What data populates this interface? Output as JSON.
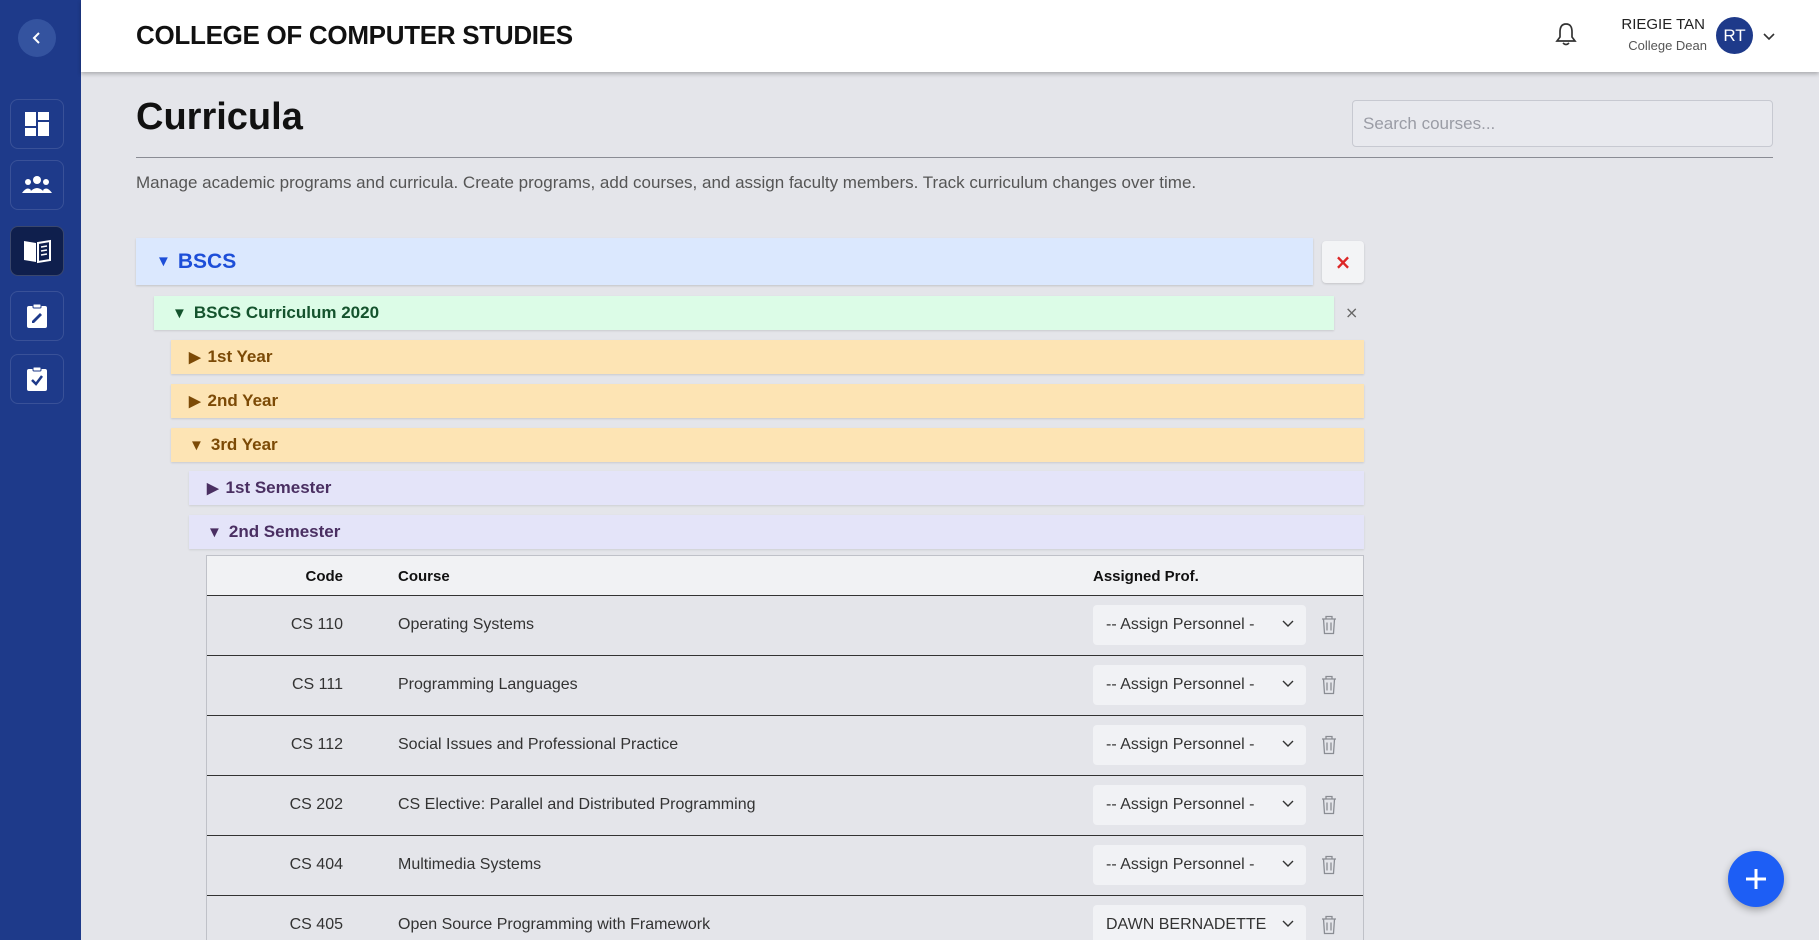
{
  "header": {
    "college_title": "COLLEGE OF COMPUTER STUDIES",
    "user_name": "RIEGIE TAN",
    "user_role": "College Dean",
    "avatar_initials": "RT"
  },
  "sidebar": {
    "items": [
      {
        "icon": "dashboard-icon"
      },
      {
        "icon": "users-icon"
      },
      {
        "icon": "book-icon",
        "active": true
      },
      {
        "icon": "clipboard-edit-icon"
      },
      {
        "icon": "clipboard-check-icon"
      }
    ]
  },
  "page": {
    "title": "Curricula",
    "search_placeholder": "Search courses...",
    "description": "Manage academic programs and curricula. Create programs, add courses, and assign faculty members. Track curriculum changes over time."
  },
  "tree": {
    "program": {
      "label": "BSCS",
      "delete": "×"
    },
    "curriculum": {
      "label": "BSCS Curriculum 2020",
      "delete": "×"
    },
    "years": [
      {
        "label": "1st Year",
        "expanded": false
      },
      {
        "label": "2nd Year",
        "expanded": false
      },
      {
        "label": "3rd Year",
        "expanded": true
      }
    ],
    "semesters": [
      {
        "label": "1st Semester",
        "expanded": false
      },
      {
        "label": "2nd Semester",
        "expanded": true
      }
    ],
    "caret_expanded": "▼",
    "caret_collapsed": "▶"
  },
  "table": {
    "headers": {
      "code": "Code",
      "course": "Course",
      "assigned": "Assigned Prof."
    },
    "rows": [
      {
        "code": "CS 110",
        "course": "Operating Systems",
        "assigned": "-- Assign Personnel -"
      },
      {
        "code": "CS 111",
        "course": "Programming Languages",
        "assigned": "-- Assign Personnel -"
      },
      {
        "code": "CS 112",
        "course": "Social Issues and Professional Practice",
        "assigned": "-- Assign Personnel -"
      },
      {
        "code": "CS 202",
        "course": "CS Elective: Parallel and Distributed Programming",
        "assigned": "-- Assign Personnel -"
      },
      {
        "code": "CS 404",
        "course": "Multimedia Systems",
        "assigned": "-- Assign Personnel -"
      },
      {
        "code": "CS 405",
        "course": "Open Source Programming with Framework",
        "assigned": "DAWN BERNADETTE"
      }
    ]
  },
  "colors": {
    "sidebar": "#1e3a8a",
    "accent": "#1d5ef5",
    "program_bg": "#dbe8fe",
    "curriculum_bg": "#dcfce7",
    "year_bg": "#fde4b4",
    "semester_bg": "#e4e4f9"
  }
}
